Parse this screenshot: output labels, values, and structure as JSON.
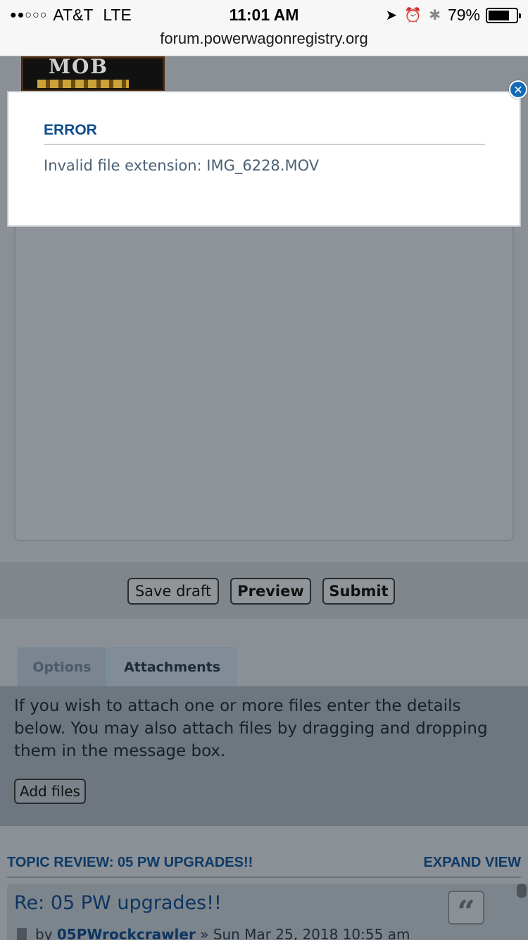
{
  "status_bar": {
    "signal": "●●○○○",
    "carrier": "AT&T",
    "network": "LTE",
    "time": "11:01 AM",
    "battery": "79%",
    "battery_level": 0.79,
    "url": "forum.powerwagonregistry.org"
  },
  "logo": {
    "text": "MOB"
  },
  "editor_buttons": {
    "save_draft": "Save draft",
    "preview": "Preview",
    "submit": "Submit"
  },
  "tabs": [
    {
      "label": "Options",
      "active": false
    },
    {
      "label": "Attachments",
      "active": true
    }
  ],
  "attachments": {
    "instructions": "If you wish to attach one or more files enter the details below. You may also attach files by dragging and dropping them in the message box.",
    "add_files": "Add files"
  },
  "topic_review": {
    "heading": "TOPIC REVIEW: 05 PW UPGRADES!!",
    "expand": "EXPAND VIEW",
    "post": {
      "title": "Re: 05 PW upgrades!!",
      "by": "by",
      "author": "05PWrockcrawler",
      "date": "» Sun Mar 25, 2018 10:55 am"
    }
  },
  "modal": {
    "title": "ERROR",
    "message": "Invalid file extension: IMG_6228.MOV"
  },
  "icons": {
    "location": "location-arrow-icon",
    "alarm": "alarm-icon",
    "bluetooth": "bluetooth-icon",
    "close": "close-icon",
    "quote": "quote-icon",
    "post": "post-icon"
  }
}
